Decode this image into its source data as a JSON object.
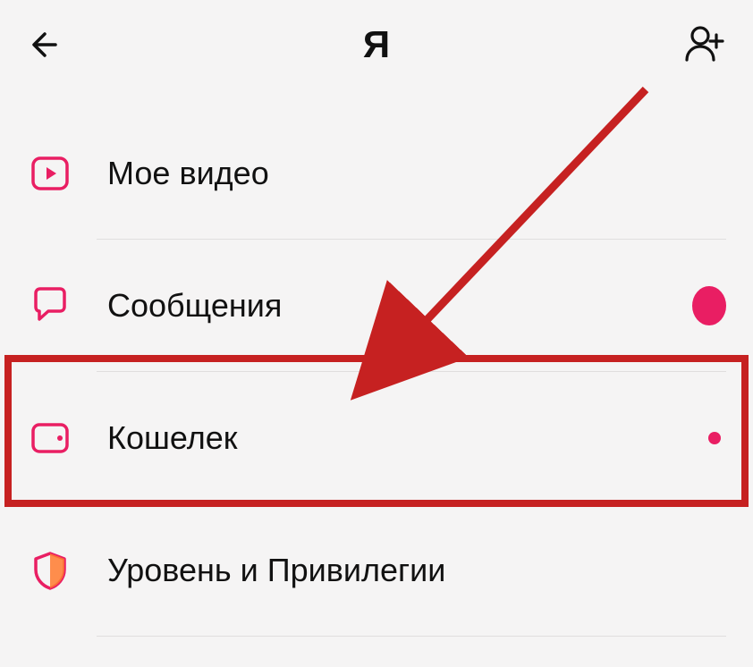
{
  "header": {
    "title": "Я"
  },
  "items": [
    {
      "label": "Мое видео"
    },
    {
      "label": "Сообщения"
    },
    {
      "label": "Кошелек"
    },
    {
      "label": "Уровень и Привилегии"
    }
  ],
  "colors": {
    "accent": "#e91e63",
    "highlight": "#c62121"
  }
}
